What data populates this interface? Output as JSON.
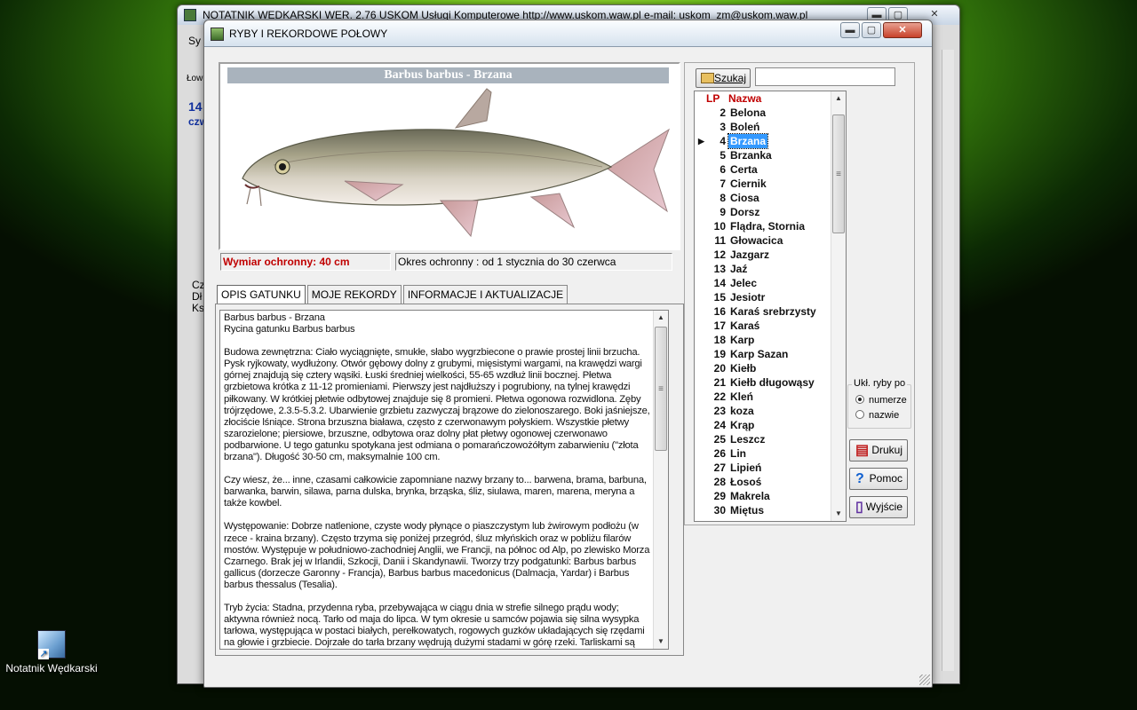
{
  "desktop": {
    "icon_label": "Notatnik Wędkarski"
  },
  "background_window": {
    "title": "NOTATNIK WEDKARSKI   WER. 2.76      USKOM Usługi Komputerowe       http://www.uskom.waw.pl        e-mail: uskom_zm@uskom.waw.pl",
    "fragments": [
      "Sy",
      "Łow",
      "14",
      "czw",
      "Cz",
      "Dł",
      "Ks"
    ]
  },
  "window": {
    "title": "RYBY I REKORDOWE POŁOWY",
    "btn_min": "▬",
    "btn_max": "▢",
    "btn_close": "✕"
  },
  "fish": {
    "heading": "Barbus barbus - Brzana",
    "min_size": "Wymiar ochronny: 40 cm",
    "closed_season": "Okres ochronny : od 1 stycznia do 30 czerwca"
  },
  "tabs": [
    "OPIS GATUNKU",
    "MOJE REKORDY",
    "INFORMACJE I AKTUALIZACJE"
  ],
  "description": [
    "Barbus barbus - Brzana\nRycina gatunku Barbus barbus",
    "Budowa zewnętrzna: Ciało wyciągnięte, smukłe, słabo wygrzbiecone o prawie prostej linii brzucha. Pysk ryjkowaty, wydłużony. Otwór gębowy dolny z grubymi, mięsistymi wargami, na krawędzi wargi górnej znajdują się cztery wąsiki. Łuski średniej wielkości, 55-65 wzdłuż linii bocznej. Płetwa grzbietowa krótka z 11-12 promieniami. Pierwszy jest najdłuższy i pogrubiony, na tylnej krawędzi piłkowany. W krótkiej płetwie odbytowej znajduje się 8 promieni. Płetwa ogonowa rozwidlona. Zęby trójrzędowe, 2.3.5-5.3.2. Ubarwienie grzbietu zazwyczaj brązowe do zielonoszarego. Boki jaśniejsze, złociście lśniące. Strona brzuszna biaława, często z czerwonawym połyskiem. Wszystkie płetwy szarozielone; piersiowe, brzuszne, odbytowa oraz dolny płat płetwy ogonowej czerwonawo podbarwione. U tego gatunku spotykana jest odmiana o pomarańczowożółtym zabarwieniu (\"złota brzana\"). Długość 30-50 cm, maksymalnie 100 cm.",
    "Czy wiesz, że... inne, czasami całkowicie zapomniane nazwy brzany to... barwena, brama, barbuna, barwanka, barwin, silawa, parna dulska, brynka, brząska, śliz, siulawa, maren, marena, meryna a także kowbel.",
    "Występowanie: Dobrze natlenione, czyste wody płynące o piaszczystym lub żwirowym podłożu (w rzece - kraina brzany). Często trzyma się poniżej przegród, śluz młyńskich oraz w pobliżu filarów mostów. Występuje w południowo-zachodniej Anglii, we Francji, na północ od Alp, po zlewisko Morza Czarnego. Brak jej w Irlandii, Szkocji, Danii i Skandynawii. Tworzy trzy podgatunki: Barbus barbus gallicus (dorzecze Garonny - Francja), Barbus barbus macedonicus (Dalmacja, Yardar) i Barbus barbus thessalus (Tesalia).",
    "Tryb życia: Stadna, przydenna ryba, przebywająca w ciągu dnia w strefie silnego prądu wody; aktywna również nocą. Tarło od maja do lipca. W tym okresie u samców pojawia się silna wysypka tarłowa, występująca w postaci białych, perełkowatych, rogowych guzków układających się rzędami na głowie i grzbiecie. Dojrzałe do tarła brzany wędrują dużymi stadami w górę rzeki. Tarliskami są żwirowe"
  ],
  "search": {
    "label": "Szukaj",
    "value": ""
  },
  "list": {
    "header_lp": "LP",
    "header_name": "Nazwa",
    "selected_index": 2,
    "rows": [
      {
        "lp": "2",
        "name": "Belona"
      },
      {
        "lp": "3",
        "name": "Boleń"
      },
      {
        "lp": "4",
        "name": "Brzana"
      },
      {
        "lp": "5",
        "name": "Brzanka"
      },
      {
        "lp": "6",
        "name": "Certa"
      },
      {
        "lp": "7",
        "name": "Ciernik"
      },
      {
        "lp": "8",
        "name": "Ciosa"
      },
      {
        "lp": "9",
        "name": "Dorsz"
      },
      {
        "lp": "10",
        "name": "Flądra, Stornia"
      },
      {
        "lp": "11",
        "name": "Głowacica"
      },
      {
        "lp": "12",
        "name": "Jazgarz"
      },
      {
        "lp": "13",
        "name": "Jaź"
      },
      {
        "lp": "14",
        "name": "Jelec"
      },
      {
        "lp": "15",
        "name": "Jesiotr"
      },
      {
        "lp": "16",
        "name": "Karaś srebrzysty"
      },
      {
        "lp": "17",
        "name": "Karaś"
      },
      {
        "lp": "18",
        "name": "Karp"
      },
      {
        "lp": "19",
        "name": "Karp Sazan"
      },
      {
        "lp": "20",
        "name": "Kiełb"
      },
      {
        "lp": "21",
        "name": "Kiełb długowąsy"
      },
      {
        "lp": "22",
        "name": "Kleń"
      },
      {
        "lp": "23",
        "name": "koza"
      },
      {
        "lp": "24",
        "name": "Krąp"
      },
      {
        "lp": "25",
        "name": "Leszcz"
      },
      {
        "lp": "26",
        "name": "Lin"
      },
      {
        "lp": "27",
        "name": "Lipień"
      },
      {
        "lp": "28",
        "name": "Łosoś"
      },
      {
        "lp": "29",
        "name": "Makrela"
      },
      {
        "lp": "30",
        "name": "Miętus"
      }
    ]
  },
  "sort": {
    "legend": "Ukł. ryby po",
    "opt_number": "numerze",
    "opt_name": "nazwie",
    "selected": "numerze"
  },
  "actions": {
    "print": "Drukuj",
    "help": "Pomoc",
    "exit": "Wyjście"
  },
  "colors": {
    "accent_red": "#c00000",
    "selection": "#3399ff",
    "title_band": "#a9b3bd"
  }
}
